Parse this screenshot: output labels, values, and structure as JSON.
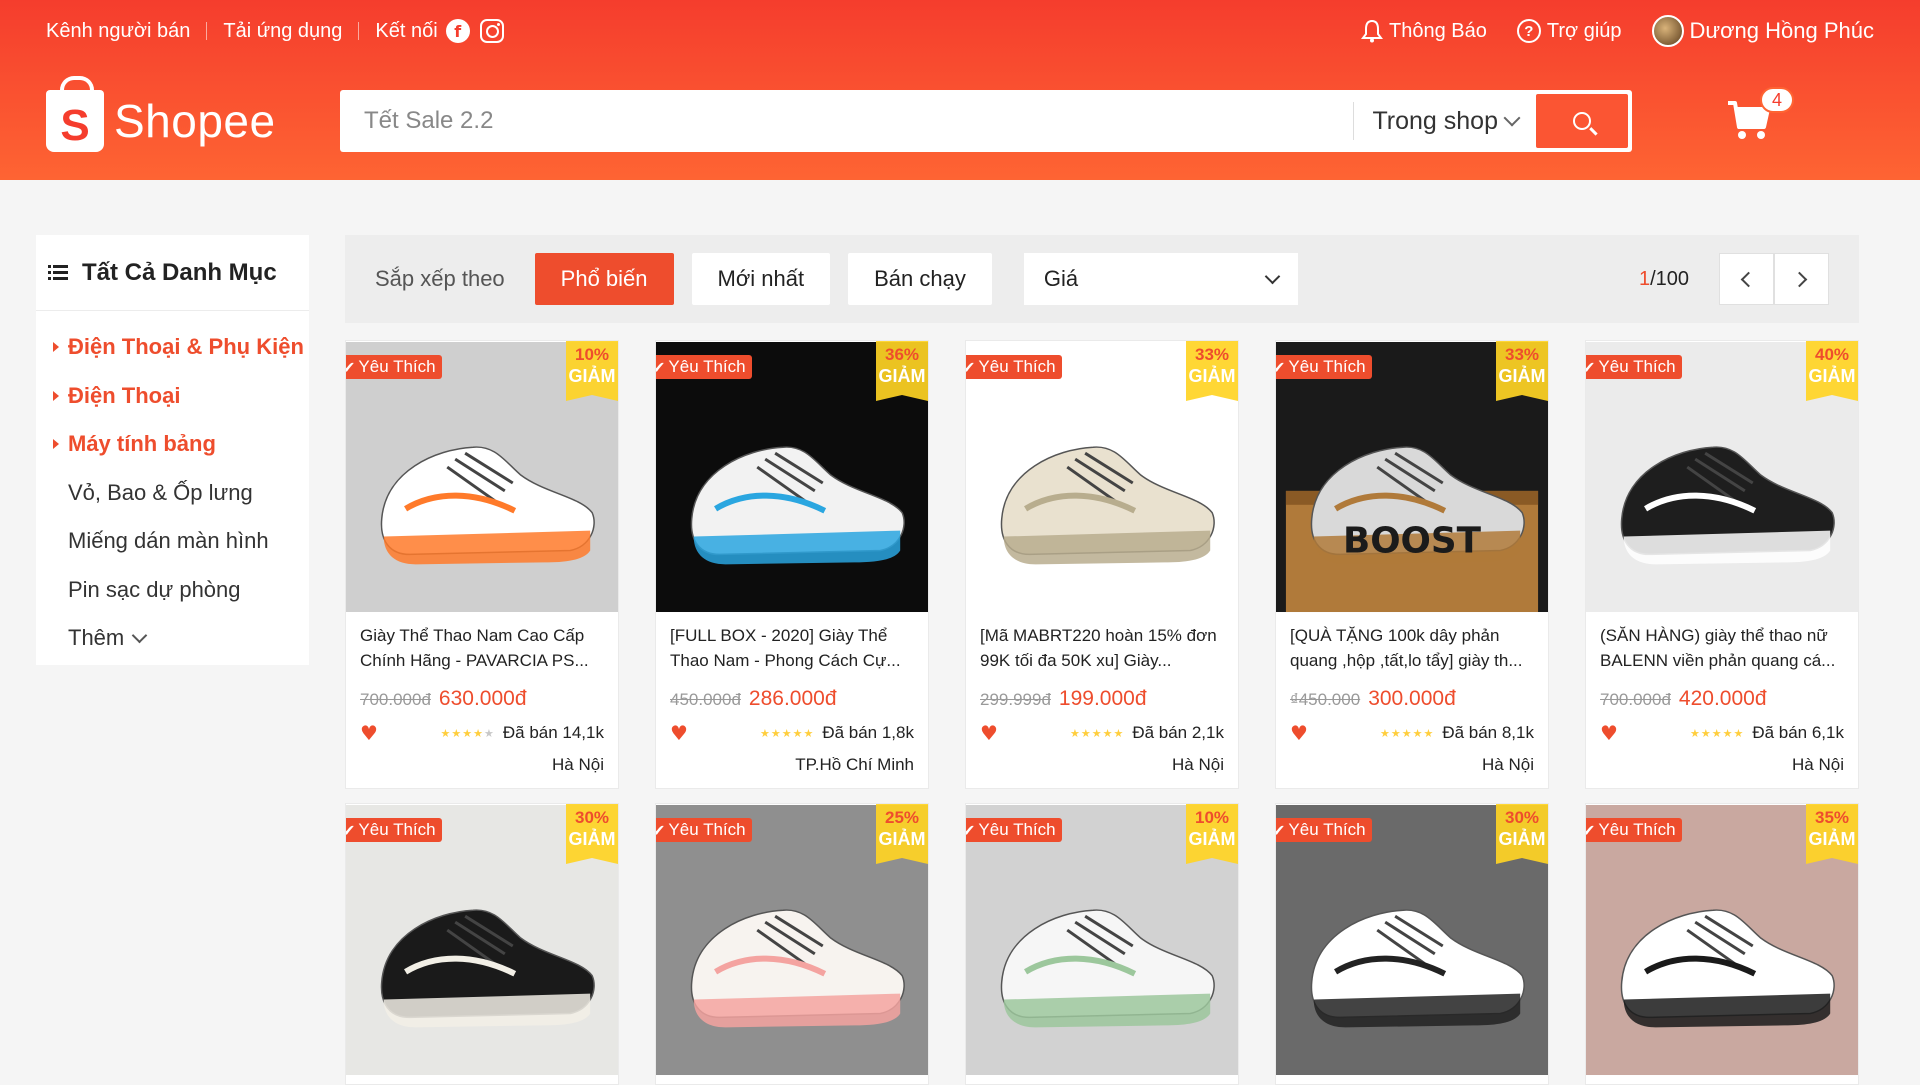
{
  "topbar": {
    "seller": "Kênh người bán",
    "download": "Tải ứng dụng",
    "connect": "Kết nối",
    "facebook_glyph": "f",
    "notifications": "Thông Báo",
    "help": "Trợ giúp",
    "help_glyph": "?",
    "user": "Dương Hồng Phúc"
  },
  "brand": {
    "name": "Shopee",
    "mark": "S"
  },
  "search": {
    "placeholder": "Tết Sale 2.2",
    "scope": "Trong shop"
  },
  "cart": {
    "count": "4"
  },
  "sidebar": {
    "title": "Tất Cả Danh Mục",
    "items": [
      {
        "label": "Điện Thoại & Phụ Kiện",
        "active": true
      },
      {
        "label": "Điện Thoại",
        "active": true
      },
      {
        "label": "Máy tính bảng",
        "active": true
      },
      {
        "label": "Vỏ, Bao & Ốp lưng",
        "active": false
      },
      {
        "label": "Miếng dán màn hình",
        "active": false
      },
      {
        "label": "Pin sạc dự phòng",
        "active": false
      }
    ],
    "more": "Thêm"
  },
  "sort": {
    "label": "Sắp xếp theo",
    "options": [
      "Phổ biến",
      "Mới nhất",
      "Bán chạy"
    ],
    "price": "Giá",
    "page_current": "1",
    "page_total": "/100"
  },
  "badges": {
    "favorite": "Yêu Thích",
    "favorite_check": "✔",
    "off": "GIẢM",
    "heart": "♥"
  },
  "products": [
    {
      "name": "Giày Thể Thao Nam Cao Cấp Chính Hãng - PAVARCIA PS...",
      "old_price": "700.000đ",
      "price": "630.000đ",
      "discount": "10%",
      "sold": "Đã bán 14,1k",
      "location": "Hà Nội",
      "rating": 4,
      "bg": "#cfcfcf",
      "shoe": "#ffffff",
      "accent": "#ff7a2a"
    },
    {
      "name": "[FULL BOX - 2020] Giày Thể Thao Nam - Phong Cách Cự...",
      "old_price": "450.000đ",
      "price": "286.000đ",
      "discount": "36%",
      "sold": "Đã bán 1,8k",
      "location": "TP.Hồ Chí Minh",
      "rating": 5,
      "bg": "#0c0c0c",
      "shoe": "#f2f2f2",
      "accent": "#2aa6e0"
    },
    {
      "name": "[Mã MABRT220 hoàn 15% đơn 99K tối đa 50K xu] Giày...",
      "old_price": "299.999đ",
      "price": "199.000đ",
      "discount": "33%",
      "sold": "Đã bán 2,1k",
      "location": "Hà Nội",
      "rating": 5,
      "bg": "#ffffff",
      "shoe": "#e9e1cf",
      "accent": "#b8ad8e"
    },
    {
      "name": "[QUÀ TẶNG 100k dây phản quang ,hộp ,tất,lo tẩy] giày th...",
      "old_price": "₫450.000",
      "price": "300.000đ",
      "discount": "33%",
      "sold": "Đã bán 8,1k",
      "location": "Hà Nội",
      "rating": 5,
      "bg": "#1a1a1a",
      "shoe": "#d9d9d9",
      "accent": "#b07a3a",
      "box_text": "BOOST"
    },
    {
      "name": "(SĂN HÀNG) giày thể thao nữ BALENN viền phản quang cá...",
      "old_price": "700.000đ",
      "price": "420.000đ",
      "discount": "40%",
      "sold": "Đã bán 6,1k",
      "location": "Hà Nội",
      "rating": 5,
      "bg": "#ebebeb",
      "shoe": "#1e1e1e",
      "accent": "#ffffff"
    },
    {
      "discount": "30%",
      "bg": "#e7e7e4",
      "shoe": "#1a1a1a",
      "accent": "#f2efe6"
    },
    {
      "discount": "25%",
      "bg": "#8f8f8f",
      "shoe": "#f7f3ef",
      "accent": "#f4a3a0"
    },
    {
      "discount": "10%",
      "bg": "#d2d2d2",
      "shoe": "#f6f6f6",
      "accent": "#9cc79c"
    },
    {
      "discount": "30%",
      "bg": "#6a6a6a",
      "shoe": "#ffffff",
      "accent": "#222222"
    },
    {
      "discount": "35%",
      "bg": "#c9a8a0",
      "shoe": "#ffffff",
      "accent": "#1a1a1a"
    }
  ]
}
